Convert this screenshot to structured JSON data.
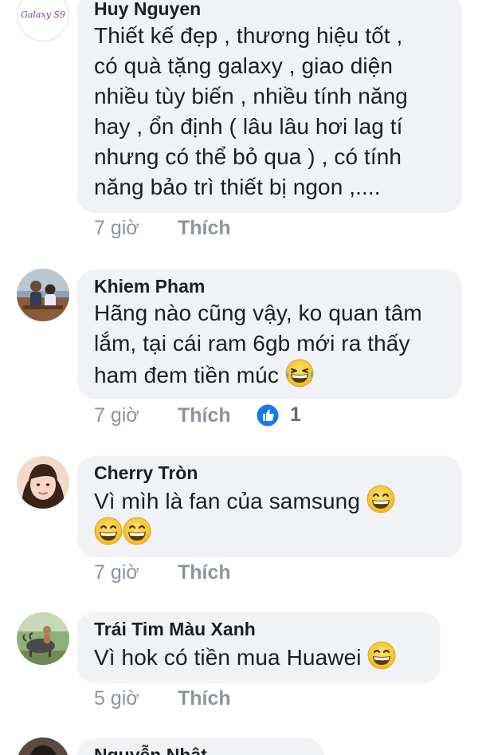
{
  "comments": [
    {
      "avatar_icon": "galaxy-s9-logo-avatar",
      "avatar_text": "Galaxy S9",
      "name": "Huy Nguyen",
      "lines": [
        "Thiết kế đẹp , thương hiệu tốt ,",
        "có quà tặng galaxy , giao diện",
        "nhiều tùy biến , nhiều tính năng",
        "hay , ổn định ( lâu lâu hơi lag tí",
        "nhưng có thể bỏ qua ) , có tính",
        "năng bảo trì thiết bị ngon ,...."
      ],
      "time": "7 giờ",
      "like_label": "Thích"
    },
    {
      "avatar_icon": "couple-photo-avatar",
      "name": "Khiem Pham",
      "lines": [
        "Hãng nào cũng vậy, ko quan tâm",
        "lắm, tại cái ram 6gb mới ra thấy",
        "ham đem tiền múc"
      ],
      "emoji": "laughing-tears-emoji",
      "time": "7 giờ",
      "like_label": "Thích",
      "reaction_icon": "like-thumb-icon",
      "reaction_count": "1"
    },
    {
      "avatar_icon": "girl-photo-avatar",
      "name": "Cherry Tròn",
      "lines": [
        "Vì mìh là fan của samsung"
      ],
      "emoji": "grinning-emoji",
      "time": "7 giờ",
      "like_label": "Thích"
    },
    {
      "avatar_icon": "buffalo-photo-avatar",
      "name": "Trái Tim Màu Xanh",
      "lines": [
        "Vì hok có tiền mua Huawei"
      ],
      "emoji": "grinning-emoji",
      "time": "5 giờ",
      "like_label": "Thích"
    },
    {
      "avatar_icon": "partial-avatar",
      "name": "Nguyễn Nhật"
    }
  ],
  "colors": {
    "bubble": "#f0f2f5",
    "meta_text": "#8d949e",
    "like_blue": "#1877f2",
    "emoji_yellow": "#f7c531"
  }
}
